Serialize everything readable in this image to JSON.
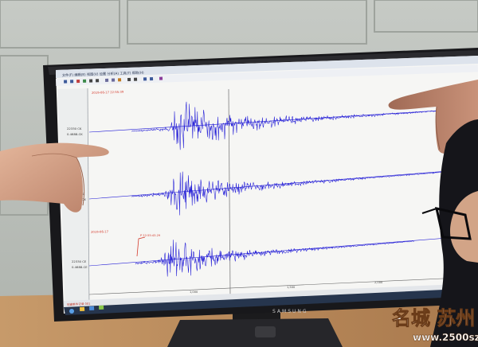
{
  "toolbar": {
    "menu_text": "文件(F)  编辑(E)  视图(V)  设置  分析(A)  工具(T)  帮助(H)"
  },
  "traces": [
    {
      "side_labels": [
        "22330 CK",
        "0.4688-CK"
      ]
    },
    {
      "side_labels": [
        "22330 CX",
        "0.4688-CX"
      ]
    },
    {
      "side_labels": [
        "22330 CE",
        "0.4688-CE"
      ]
    }
  ],
  "annotations": {
    "top_left": "2019-06-17 22:55:39",
    "phase_pick": "P 22:55:43.29",
    "mid_left": "2019-06-17"
  },
  "time_axis": {
    "ticks": [
      "1,000",
      "1,500",
      "2,000",
      "2,500"
    ]
  },
  "status_text": "地震事件记录 001",
  "brand": "SAMSUNG",
  "watermark": {
    "name": "名城 苏州",
    "url": "www.2500sz.com"
  },
  "colors": {
    "trace": "#1f19d6",
    "pick": "#d43a2c",
    "screen": "#f6f6f4"
  }
}
